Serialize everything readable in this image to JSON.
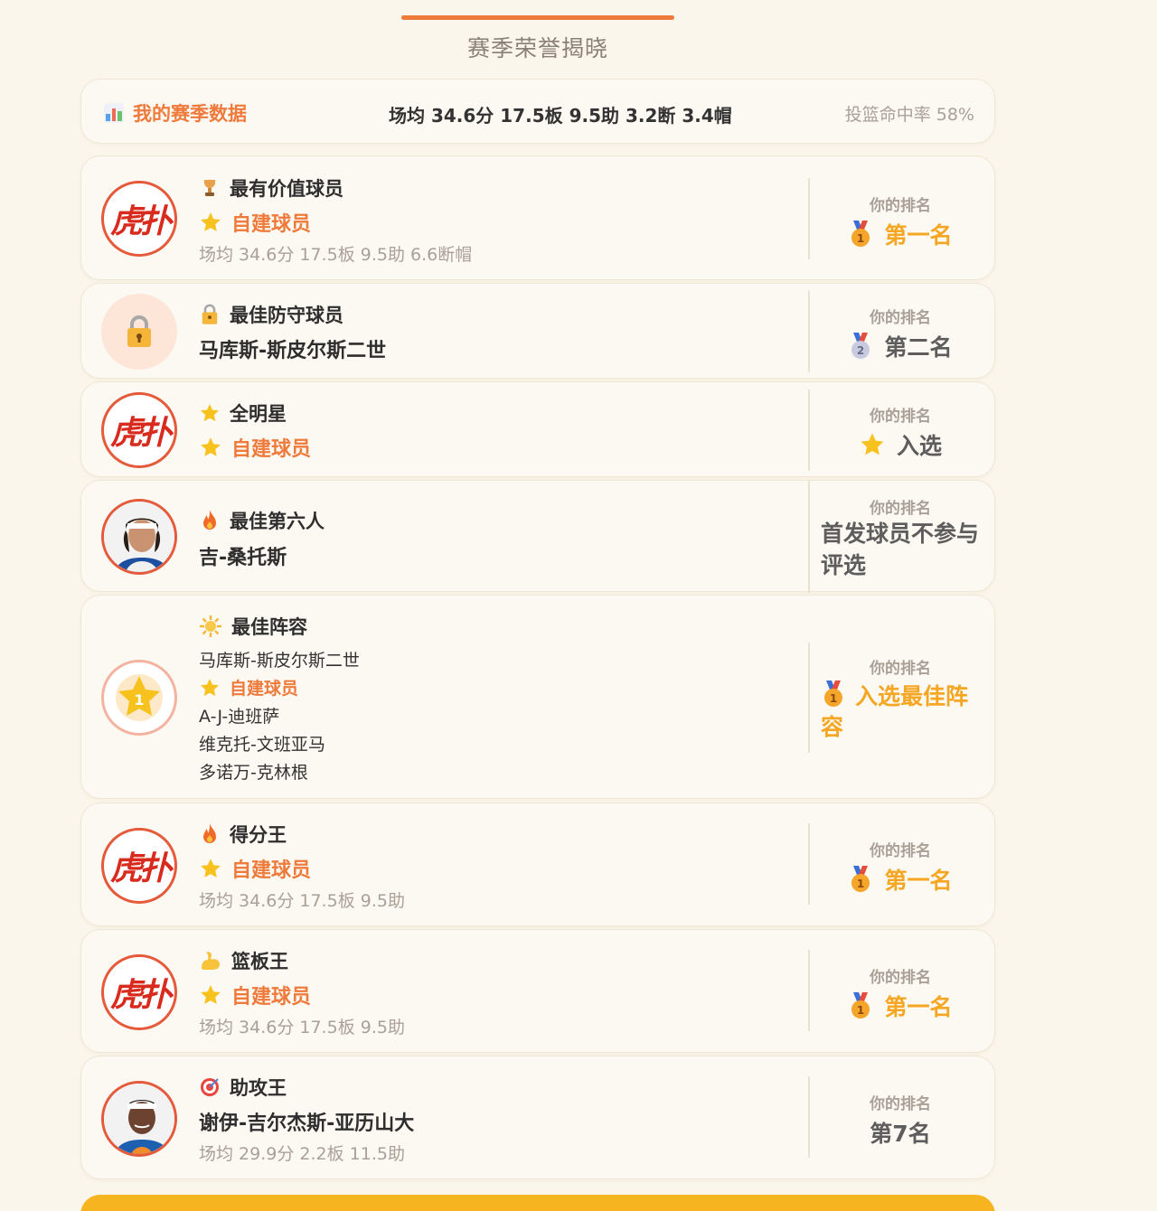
{
  "page_title": "赛季荣誉揭晓",
  "stats": {
    "label": "我的赛季数据",
    "line": "场均 34.6分 17.5板 9.5助 3.2断 3.4帽",
    "pct": "投篮命中率 58%"
  },
  "rank_label": "你的排名",
  "logo_text": "虎扑",
  "awards": [
    {
      "title": "最有价值球员",
      "icon": "trophy-icon",
      "winner": "自建球员",
      "detail": "场均 34.6分 17.5板 9.5助 6.6断帽",
      "rank": "第一名",
      "medal": "gold-medal-icon"
    },
    {
      "title": "最佳防守球员",
      "icon": "lock-icon",
      "winner": "马库斯-斯皮尔斯二世",
      "rank": "第二名",
      "medal": "silver-medal-icon"
    },
    {
      "title": "全明星",
      "icon": "star-icon",
      "winner": "自建球员",
      "rank": "入选",
      "medal": "star-icon"
    },
    {
      "title": "最佳第六人",
      "icon": "fire-icon",
      "winner": "吉-桑托斯",
      "rank": "首发球员不参与评选"
    },
    {
      "title": "最佳阵容",
      "icon": "sun-icon",
      "lineup": [
        "马库斯-斯皮尔斯二世",
        "自建球员",
        "A-J-迪班萨",
        "维克托-文班亚马",
        "多诺万-克林根"
      ],
      "rank": "入选最佳阵容",
      "medal": "gold-medal-icon"
    },
    {
      "title": "得分王",
      "icon": "fire-icon",
      "winner": "自建球员",
      "detail": "场均 34.6分 17.5板 9.5助",
      "rank": "第一名",
      "medal": "gold-medal-icon"
    },
    {
      "title": "篮板王",
      "icon": "muscle-icon",
      "winner": "自建球员",
      "detail": "场均 34.6分 17.5板 9.5助",
      "rank": "第一名",
      "medal": "gold-medal-icon"
    },
    {
      "title": "助攻王",
      "icon": "target-icon",
      "winner": "谢伊-吉尔杰斯-亚历山大",
      "detail": "场均 29.9分 2.2板 11.5助",
      "rank": "第7名"
    }
  ],
  "colors": {
    "accent": "#ee7a3c",
    "gold": "#f5a623",
    "background": "#fbf6ec"
  }
}
